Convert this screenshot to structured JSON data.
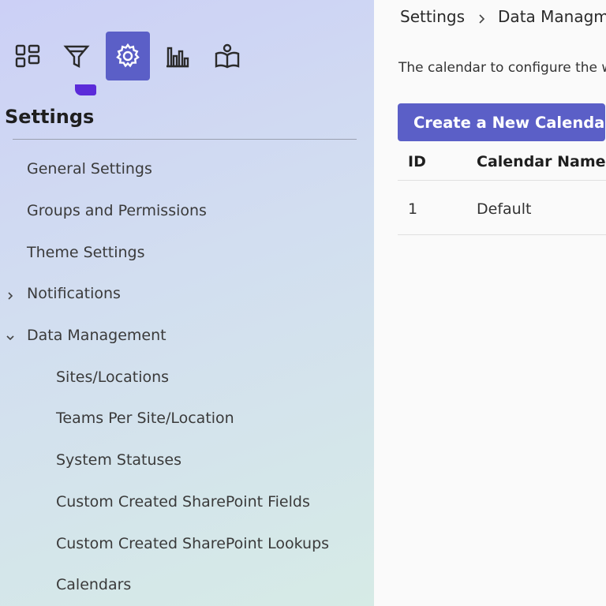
{
  "nav": {
    "icons": [
      "dashboard-icon",
      "filter-icon",
      "settings-icon",
      "bar-chart-icon",
      "book-reader-icon"
    ],
    "active_index": 2,
    "accent_color": "#5b5fc7",
    "indicator_color": "#5b2bd9"
  },
  "sidebar": {
    "title": "Settings",
    "items": [
      {
        "label": "General Settings"
      },
      {
        "label": "Groups and Permissions"
      },
      {
        "label": "Theme Settings"
      },
      {
        "label": "Notifications",
        "chevron": "chevron-right-icon"
      },
      {
        "label": "Data Management",
        "chevron": "chevron-down-icon"
      },
      {
        "label": "Sites/Locations"
      },
      {
        "label": "Teams Per Site/Location"
      },
      {
        "label": "System Statuses"
      },
      {
        "label": "Custom Created SharePoint Fields"
      },
      {
        "label": "Custom Created SharePoint Lookups"
      },
      {
        "label": "Calendars"
      }
    ]
  },
  "breadcrumb": {
    "root": "Settings",
    "current": "Data Managm"
  },
  "main": {
    "description": "The calendar to configure the wo",
    "create_button": "Create a New Calendar",
    "table": {
      "columns": [
        "ID",
        "Calendar Name"
      ],
      "rows": [
        [
          "1",
          "Default"
        ]
      ]
    }
  }
}
